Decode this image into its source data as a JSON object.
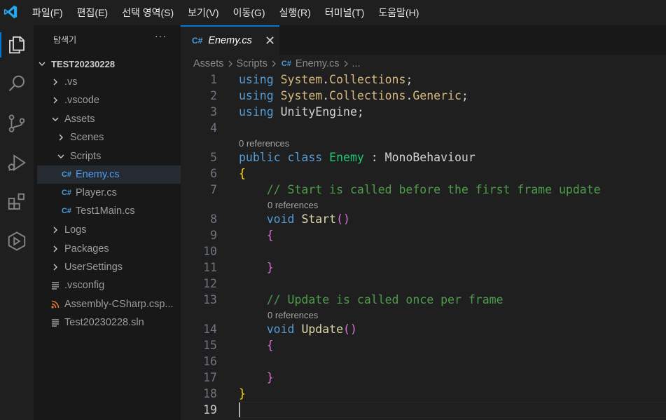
{
  "menu": [
    "파일(F)",
    "편집(E)",
    "선택 영역(S)",
    "보기(V)",
    "이동(G)",
    "실행(R)",
    "터미널(T)",
    "도움말(H)"
  ],
  "activity_icons": [
    "explorer-icon",
    "search-icon",
    "source-control-icon",
    "run-debug-icon",
    "extensions-icon",
    "unity-icon"
  ],
  "sidebar": {
    "title": "탐색기",
    "more": "···",
    "root": "TEST20230228",
    "items": [
      {
        "label": ".vs",
        "kind": "folder-collapsed",
        "depth": 1
      },
      {
        "label": ".vscode",
        "kind": "folder-collapsed",
        "depth": 1
      },
      {
        "label": "Assets",
        "kind": "folder-expanded",
        "depth": 1
      },
      {
        "label": "Scenes",
        "kind": "folder-collapsed",
        "depth": 2
      },
      {
        "label": "Scripts",
        "kind": "folder-expanded",
        "depth": 2
      },
      {
        "label": "Enemy.cs",
        "kind": "cs",
        "depth": 3,
        "selected": true
      },
      {
        "label": "Player.cs",
        "kind": "cs",
        "depth": 3
      },
      {
        "label": "Test1Main.cs",
        "kind": "cs",
        "depth": 3
      },
      {
        "label": "Logs",
        "kind": "folder-collapsed",
        "depth": 1
      },
      {
        "label": "Packages",
        "kind": "folder-collapsed",
        "depth": 1
      },
      {
        "label": "UserSettings",
        "kind": "folder-collapsed",
        "depth": 1
      },
      {
        "label": ".vsconfig",
        "kind": "file",
        "depth": 1
      },
      {
        "label": "Assembly-CSharp.csp...",
        "kind": "rss",
        "depth": 1
      },
      {
        "label": "Test20230228.sln",
        "kind": "file",
        "depth": 1
      }
    ]
  },
  "tab": {
    "icon": "C#",
    "label": "Enemy.cs",
    "close": "✕"
  },
  "breadcrumb": [
    "Assets",
    "Scripts",
    "Enemy.cs",
    "..."
  ],
  "breadcrumb_icon": "C#",
  "editor": {
    "codelens": "0 references",
    "lines": [
      {
        "n": "1",
        "tokens": [
          [
            "kw",
            "using"
          ],
          [
            "txt",
            " "
          ],
          [
            "ns",
            "System"
          ],
          [
            "txt",
            "."
          ],
          [
            "ns",
            "Collections"
          ],
          [
            "txt",
            ";"
          ]
        ]
      },
      {
        "n": "2",
        "tokens": [
          [
            "kw",
            "using"
          ],
          [
            "txt",
            " "
          ],
          [
            "ns",
            "System"
          ],
          [
            "txt",
            "."
          ],
          [
            "ns",
            "Collections"
          ],
          [
            "txt",
            "."
          ],
          [
            "ns",
            "Generic"
          ],
          [
            "txt",
            ";"
          ]
        ]
      },
      {
        "n": "3",
        "tokens": [
          [
            "kw",
            "using"
          ],
          [
            "txt",
            " "
          ],
          [
            "txt",
            "UnityEngine"
          ],
          [
            "txt",
            ";"
          ]
        ]
      },
      {
        "n": "4",
        "tokens": []
      },
      {
        "n": "5",
        "lens": true,
        "tokens": [
          [
            "kw",
            "public"
          ],
          [
            "txt",
            " "
          ],
          [
            "kw",
            "class"
          ],
          [
            "txt",
            " "
          ],
          [
            "cls",
            "Enemy"
          ],
          [
            "txt",
            " : "
          ],
          [
            "txt",
            "MonoBehaviour"
          ]
        ]
      },
      {
        "n": "6",
        "tokens": [
          [
            "br1",
            "{"
          ]
        ]
      },
      {
        "n": "7",
        "tokens": [
          [
            "txt",
            "    "
          ],
          [
            "cm",
            "// Start is called before the first frame update"
          ]
        ]
      },
      {
        "n": "8",
        "lens": true,
        "tokens": [
          [
            "txt",
            "    "
          ],
          [
            "kw",
            "void"
          ],
          [
            "txt",
            " "
          ],
          [
            "fn",
            "Start"
          ],
          [
            "br2",
            "()"
          ]
        ]
      },
      {
        "n": "9",
        "tokens": [
          [
            "txt",
            "    "
          ],
          [
            "br2",
            "{"
          ]
        ]
      },
      {
        "n": "10",
        "tokens": []
      },
      {
        "n": "11",
        "tokens": [
          [
            "txt",
            "    "
          ],
          [
            "br2",
            "}"
          ]
        ]
      },
      {
        "n": "12",
        "tokens": []
      },
      {
        "n": "13",
        "tokens": [
          [
            "txt",
            "    "
          ],
          [
            "cm",
            "// Update is called once per frame"
          ]
        ]
      },
      {
        "n": "14",
        "lens": true,
        "tokens": [
          [
            "txt",
            "    "
          ],
          [
            "kw",
            "void"
          ],
          [
            "txt",
            " "
          ],
          [
            "fn",
            "Update"
          ],
          [
            "br2",
            "()"
          ]
        ]
      },
      {
        "n": "15",
        "tokens": [
          [
            "txt",
            "    "
          ],
          [
            "br2",
            "{"
          ]
        ]
      },
      {
        "n": "16",
        "tokens": []
      },
      {
        "n": "17",
        "tokens": [
          [
            "txt",
            "    "
          ],
          [
            "br2",
            "}"
          ]
        ]
      },
      {
        "n": "18",
        "tokens": [
          [
            "br1",
            "}"
          ]
        ]
      },
      {
        "n": "19",
        "tokens": [],
        "current": true
      }
    ]
  },
  "colors": {
    "accent": "#0078d4",
    "keyword": "#569cd6",
    "namespace": "#d7ba7d",
    "class": "#21c773",
    "function": "#dcdcaa",
    "comment": "#4e9d4a",
    "bracket1": "#ffd700",
    "bracket2": "#da70d6"
  }
}
